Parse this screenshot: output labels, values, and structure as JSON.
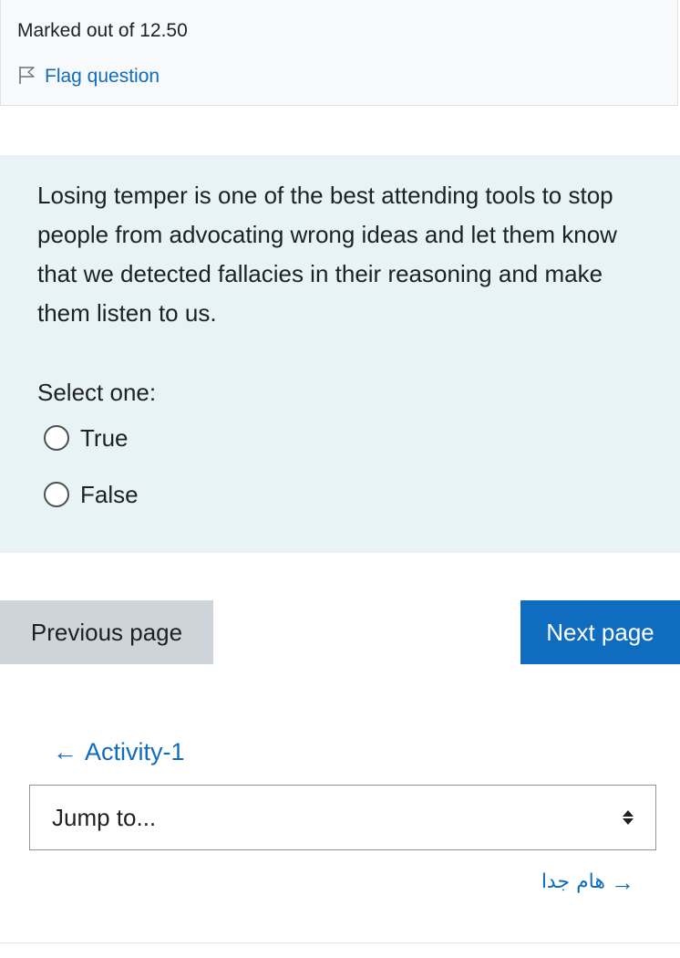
{
  "info": {
    "marked_out_of": "Marked out of 12.50",
    "flag_label": "Flag question"
  },
  "question": {
    "text": "Losing temper is one of the best attending tools to stop people from advocating wrong ideas and let them know that we detected fallacies in their reasoning and make them listen to us.",
    "prompt": "Select one:",
    "options": [
      {
        "label": "True",
        "selected": false
      },
      {
        "label": "False",
        "selected": false
      }
    ]
  },
  "navigation": {
    "previous_label": "Previous page",
    "next_label": "Next page"
  },
  "activity_nav": {
    "prev_arrow": "←",
    "prev_activity": "Activity-1",
    "jump_placeholder": "Jump to...",
    "next_activity": "هام جدا",
    "next_arrow": "→"
  },
  "colors": {
    "link": "#0f6cbf",
    "question_bg": "#e7f3f5",
    "primary_button": "#0f6cbf",
    "secondary_button": "#ced4da"
  }
}
